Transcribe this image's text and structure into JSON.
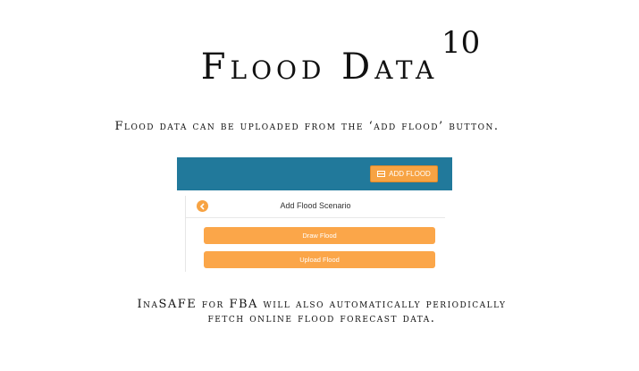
{
  "slide": {
    "title": "Flood Data",
    "number": "10",
    "intro": "Flood data can be uploaded from the ‘add flood’ button.",
    "footer_line1": "InaSAFE for FBA will also automatically periodically",
    "footer_line2": "fetch online flood forecast data."
  },
  "screenshot": {
    "header": {
      "add_flood_label": "ADD FLOOD",
      "accent_color": "#21799b",
      "button_color": "#f7a343"
    },
    "panel": {
      "title": "Add Flood Scenario",
      "back_icon": "chevron-left-icon",
      "buttons": [
        {
          "label": "Draw Flood"
        },
        {
          "label": "Upload Flood"
        }
      ]
    }
  }
}
